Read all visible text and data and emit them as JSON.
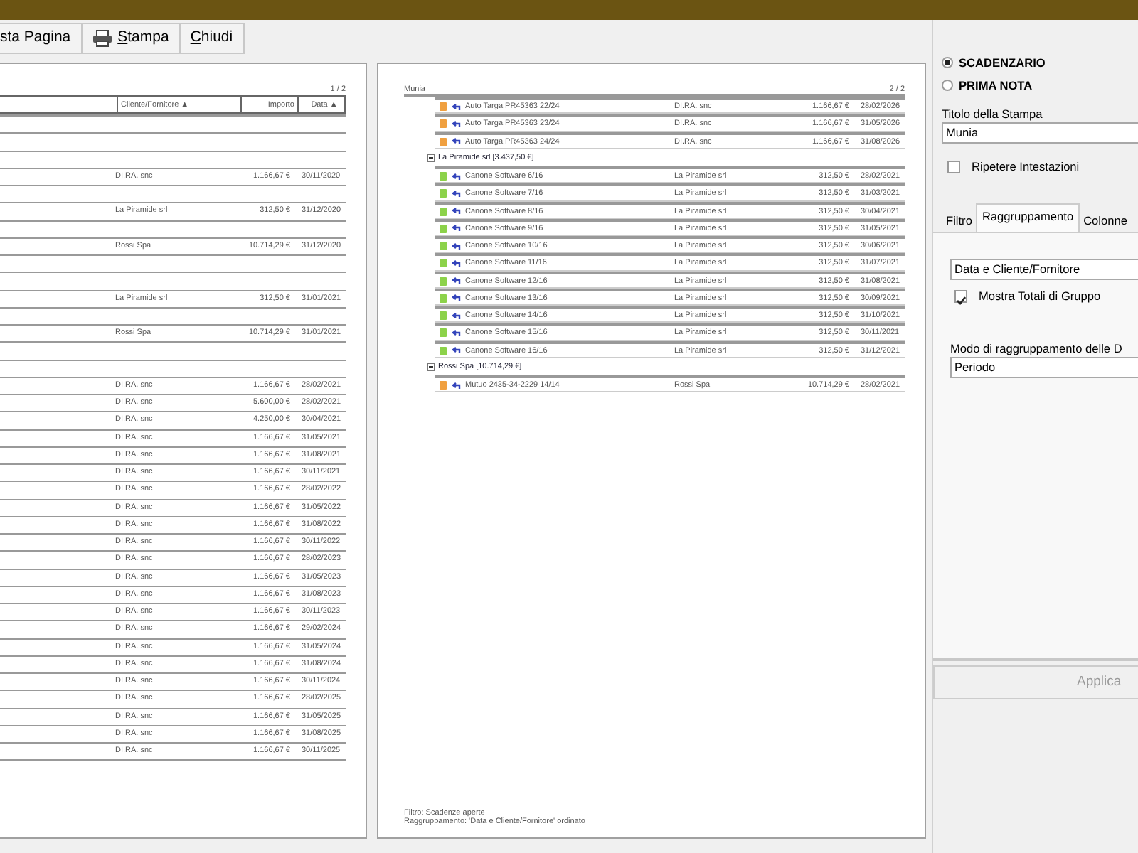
{
  "toolbar": {
    "buttons": [
      {
        "kind": "plain",
        "parts": [
          {
            "text": "sta Pagina",
            "underlined": false
          }
        ]
      },
      {
        "kind": "print",
        "parts": [
          {
            "text": "S",
            "underlined": true
          },
          {
            "text": "tampa",
            "underlined": false
          }
        ]
      },
      {
        "kind": "plain",
        "parts": [
          {
            "text": "C",
            "underlined": true
          },
          {
            "text": "hiudi",
            "underlined": false
          }
        ]
      }
    ]
  },
  "pages": [
    {
      "page_number": "1 / 2",
      "columns": [
        "Cliente/Fornitore ▲",
        "Importo",
        "Data ▲"
      ],
      "rows": [
        {
          "kind": "group"
        },
        {
          "kind": "group"
        },
        {
          "kind": "group"
        },
        {
          "kind": "item",
          "client": "DI.RA. snc",
          "amount": "1.166,67 €",
          "date": "30/11/2020"
        },
        {
          "kind": "group"
        },
        {
          "kind": "item",
          "client": "La Piramide srl",
          "amount": "312,50 €",
          "date": "31/12/2020"
        },
        {
          "kind": "group"
        },
        {
          "kind": "item",
          "client": "Rossi Spa",
          "amount": "10.714,29 €",
          "date": "31/12/2020"
        },
        {
          "kind": "group"
        },
        {
          "kind": "group"
        },
        {
          "kind": "item",
          "client": "La Piramide srl",
          "amount": "312,50 €",
          "date": "31/01/2021"
        },
        {
          "kind": "group"
        },
        {
          "kind": "item",
          "client": "Rossi Spa",
          "amount": "10.714,29 €",
          "date": "31/01/2021"
        },
        {
          "kind": "group"
        },
        {
          "kind": "group"
        },
        {
          "kind": "item",
          "client": "DI.RA. snc",
          "amount": "1.166,67 €",
          "date": "28/02/2021"
        },
        {
          "kind": "item",
          "client": "DI.RA. snc",
          "amount": "5.600,00 €",
          "date": "28/02/2021"
        },
        {
          "kind": "item",
          "client": "DI.RA. snc",
          "amount": "4.250,00 €",
          "date": "30/04/2021"
        },
        {
          "kind": "item",
          "client": "DI.RA. snc",
          "amount": "1.166,67 €",
          "date": "31/05/2021"
        },
        {
          "kind": "item",
          "client": "DI.RA. snc",
          "amount": "1.166,67 €",
          "date": "31/08/2021"
        },
        {
          "kind": "item",
          "client": "DI.RA. snc",
          "amount": "1.166,67 €",
          "date": "30/11/2021"
        },
        {
          "kind": "item",
          "client": "DI.RA. snc",
          "amount": "1.166,67 €",
          "date": "28/02/2022"
        },
        {
          "kind": "item",
          "client": "DI.RA. snc",
          "amount": "1.166,67 €",
          "date": "31/05/2022"
        },
        {
          "kind": "item",
          "client": "DI.RA. snc",
          "amount": "1.166,67 €",
          "date": "31/08/2022"
        },
        {
          "kind": "item",
          "client": "DI.RA. snc",
          "amount": "1.166,67 €",
          "date": "30/11/2022"
        },
        {
          "kind": "item",
          "client": "DI.RA. snc",
          "amount": "1.166,67 €",
          "date": "28/02/2023"
        },
        {
          "kind": "item",
          "client": "DI.RA. snc",
          "amount": "1.166,67 €",
          "date": "31/05/2023"
        },
        {
          "kind": "item",
          "client": "DI.RA. snc",
          "amount": "1.166,67 €",
          "date": "31/08/2023"
        },
        {
          "kind": "item",
          "client": "DI.RA. snc",
          "amount": "1.166,67 €",
          "date": "30/11/2023"
        },
        {
          "kind": "item",
          "client": "DI.RA. snc",
          "amount": "1.166,67 €",
          "date": "29/02/2024"
        },
        {
          "kind": "item",
          "client": "DI.RA. snc",
          "amount": "1.166,67 €",
          "date": "31/05/2024"
        },
        {
          "kind": "item",
          "client": "DI.RA. snc",
          "amount": "1.166,67 €",
          "date": "31/08/2024"
        },
        {
          "kind": "item",
          "client": "DI.RA. snc",
          "amount": "1.166,67 €",
          "date": "30/11/2024"
        },
        {
          "kind": "item",
          "client": "DI.RA. snc",
          "amount": "1.166,67 €",
          "date": "28/02/2025"
        },
        {
          "kind": "item",
          "client": "DI.RA. snc",
          "amount": "1.166,67 €",
          "date": "31/05/2025"
        },
        {
          "kind": "item",
          "client": "DI.RA. snc",
          "amount": "1.166,67 €",
          "date": "31/08/2025"
        },
        {
          "kind": "item",
          "client": "DI.RA. snc",
          "amount": "1.166,67 €",
          "date": "30/11/2025"
        }
      ]
    },
    {
      "title": "Munia",
      "page_number": "2 / 2",
      "rows": [
        {
          "kind": "item",
          "color": "#f0a040",
          "description": "Auto Targa PR45363 22/24",
          "client": "DI.RA. snc",
          "amount": "1.166,67 €",
          "date": "28/02/2026"
        },
        {
          "kind": "item",
          "color": "#f0a040",
          "description": "Auto Targa PR45363 23/24",
          "client": "DI.RA. snc",
          "amount": "1.166,67 €",
          "date": "31/05/2026"
        },
        {
          "kind": "item",
          "color": "#f0a040",
          "description": "Auto Targa PR45363 24/24",
          "client": "DI.RA. snc",
          "amount": "1.166,67 €",
          "date": "31/08/2026"
        },
        {
          "kind": "group",
          "label": "La Piramide srl [3.437,50 €]"
        },
        {
          "kind": "item",
          "color": "#8cd24a",
          "description": "Canone Software  6/16",
          "client": "La Piramide srl",
          "amount": "312,50 €",
          "date": "28/02/2021"
        },
        {
          "kind": "item",
          "color": "#8cd24a",
          "description": "Canone Software  7/16",
          "client": "La Piramide srl",
          "amount": "312,50 €",
          "date": "31/03/2021"
        },
        {
          "kind": "item",
          "color": "#8cd24a",
          "description": "Canone Software  8/16",
          "client": "La Piramide srl",
          "amount": "312,50 €",
          "date": "30/04/2021"
        },
        {
          "kind": "item",
          "color": "#8cd24a",
          "description": "Canone Software  9/16",
          "client": "La Piramide srl",
          "amount": "312,50 €",
          "date": "31/05/2021"
        },
        {
          "kind": "item",
          "color": "#8cd24a",
          "description": "Canone Software  10/16",
          "client": "La Piramide srl",
          "amount": "312,50 €",
          "date": "30/06/2021"
        },
        {
          "kind": "item",
          "color": "#8cd24a",
          "description": "Canone Software  11/16",
          "client": "La Piramide srl",
          "amount": "312,50 €",
          "date": "31/07/2021"
        },
        {
          "kind": "item",
          "color": "#8cd24a",
          "description": "Canone Software  12/16",
          "client": "La Piramide srl",
          "amount": "312,50 €",
          "date": "31/08/2021"
        },
        {
          "kind": "item",
          "color": "#8cd24a",
          "description": "Canone Software  13/16",
          "client": "La Piramide srl",
          "amount": "312,50 €",
          "date": "30/09/2021"
        },
        {
          "kind": "item",
          "color": "#8cd24a",
          "description": "Canone Software  14/16",
          "client": "La Piramide srl",
          "amount": "312,50 €",
          "date": "31/10/2021"
        },
        {
          "kind": "item",
          "color": "#8cd24a",
          "description": "Canone Software  15/16",
          "client": "La Piramide srl",
          "amount": "312,50 €",
          "date": "30/11/2021"
        },
        {
          "kind": "item",
          "color": "#8cd24a",
          "description": "Canone Software  16/16",
          "client": "La Piramide srl",
          "amount": "312,50 €",
          "date": "31/12/2021"
        },
        {
          "kind": "group",
          "label": "Rossi Spa [10.714,29 €]"
        },
        {
          "kind": "item",
          "color": "#f0a040",
          "description": "Mutuo 2435-34-2229 14/14",
          "client": "Rossi Spa",
          "amount": "10.714,29 €",
          "date": "28/02/2021"
        }
      ],
      "footer": [
        "Filtro: Scadenze aperte",
        "Raggruppamento: 'Data e Cliente/Fornitore' ordinato"
      ]
    }
  ],
  "panel": {
    "report_types": [
      {
        "label": "SCADENZARIO",
        "selected": true
      },
      {
        "label": "PRIMA NOTA",
        "selected": false
      }
    ],
    "title_label": "Titolo della Stampa",
    "title_value": "Munia",
    "repeat_headers": {
      "label": "Ripetere Intestazioni",
      "checked": false
    },
    "tabs": [
      {
        "label": "Filtro",
        "selected": false
      },
      {
        "label": "Raggruppamento",
        "selected": true
      },
      {
        "label": "Colonne",
        "selected": false
      }
    ],
    "grouping": "Data e Cliente/Fornitore",
    "show_totals": {
      "label": "Mostra Totali di Gruppo",
      "checked": true
    },
    "date_mode_label": "Modo di raggruppamento delle D",
    "date_mode": "Periodo",
    "apply_button": {
      "label": "Applica",
      "disabled": true
    }
  }
}
